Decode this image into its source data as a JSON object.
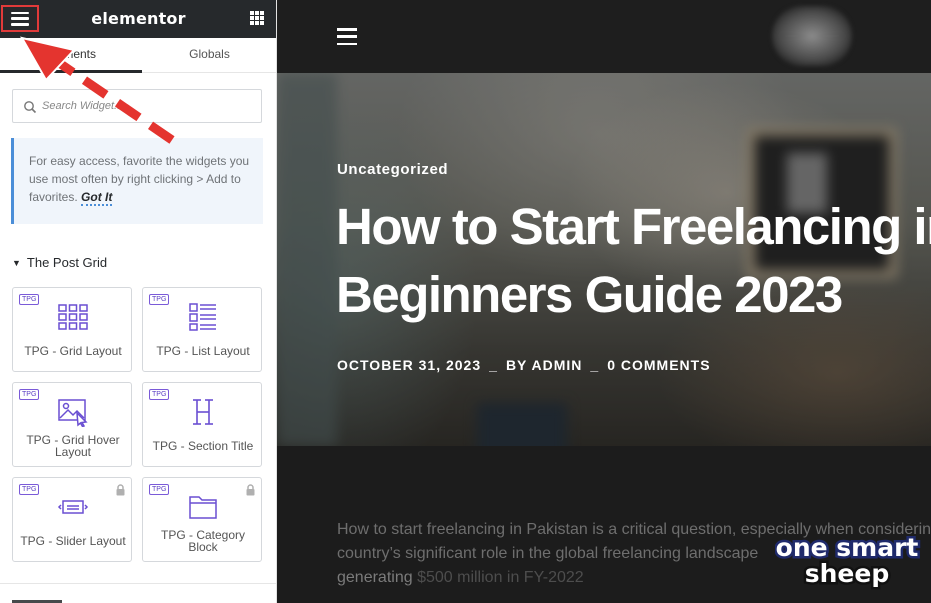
{
  "editor": {
    "brand": "elementor",
    "tabs": [
      {
        "label": "Elements"
      },
      {
        "label": "Globals"
      }
    ],
    "search": {
      "placeholder": "Search Widget..."
    },
    "notice": {
      "text": "For easy access, favorite the widgets you use most often by right clicking > Add to favorites.",
      "link": "Got It"
    },
    "category": {
      "title": "The Post Grid"
    },
    "widgets": [
      {
        "badge": "TPG",
        "label": "TPG - Grid Layout",
        "icon": "grid-layout-icon",
        "locked": false
      },
      {
        "badge": "TPG",
        "label": "TPG - List Layout",
        "icon": "list-layout-icon",
        "locked": false
      },
      {
        "badge": "TPG",
        "label": "TPG - Grid Hover Layout",
        "icon": "image-hover-icon",
        "locked": false
      },
      {
        "badge": "TPG",
        "label": "TPG - Section Title",
        "icon": "heading-icon",
        "locked": false
      },
      {
        "badge": "TPG",
        "label": "TPG - Slider Layout",
        "icon": "slider-icon",
        "locked": true
      },
      {
        "badge": "TPG",
        "label": "TPG - Category Block",
        "icon": "folder-icon",
        "locked": true
      }
    ],
    "accent_color": "#7a5ad8",
    "highlight_color": "#e03a3a"
  },
  "preview": {
    "post": {
      "category": "Uncategorized",
      "title_line1": "How to Start Freelancing in Pakistan:",
      "title_line2": "Beginners Guide 2023",
      "date": "OCTOBER 31, 2023",
      "author": "BY ADMIN",
      "comments": "0 COMMENTS"
    },
    "excerpt": {
      "line1": "How to start freelancing in Pakistan is a critical question, especially when considering the",
      "line2": "country’s significant role in the global freelancing landscape",
      "line3_a": "generating",
      "line3_b": "$500 million in FY-2022"
    },
    "watermark": {
      "line1": "one smart",
      "line2": "sheep"
    }
  }
}
